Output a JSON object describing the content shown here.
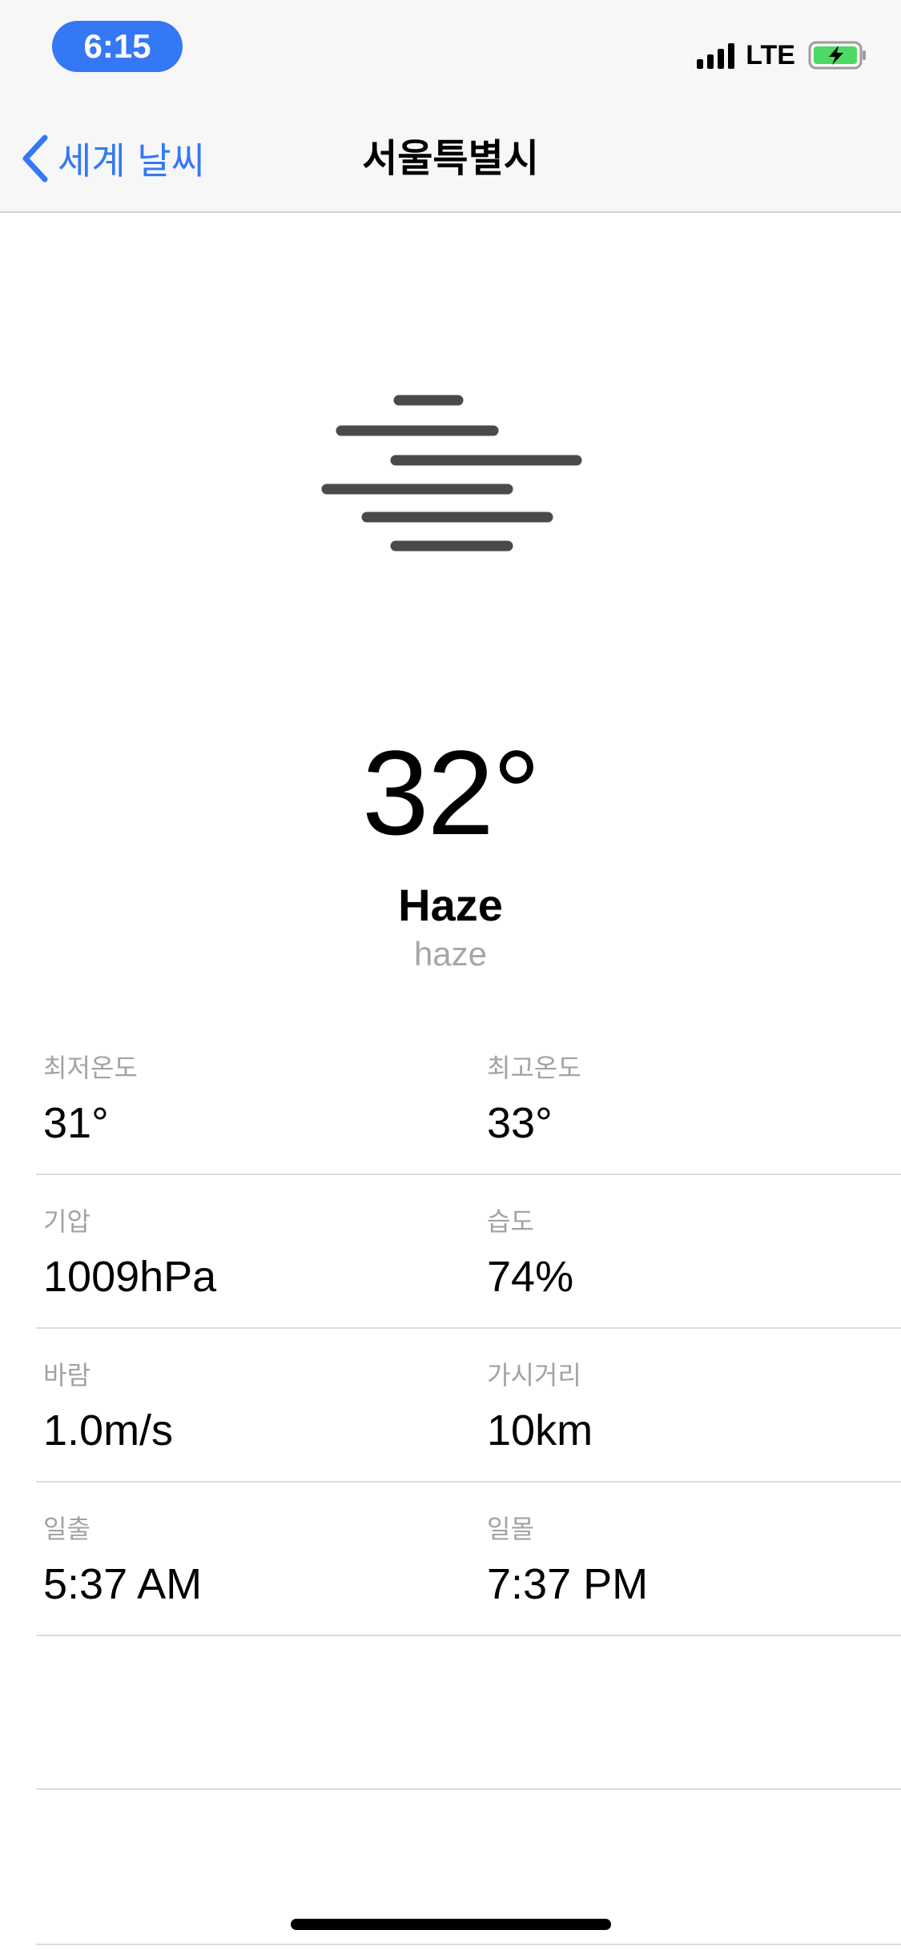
{
  "status_bar": {
    "time": "6:15",
    "network": "LTE",
    "time_pill_color": "#3478f6",
    "battery_color": "#4cd964"
  },
  "nav": {
    "back_label": "세계 날씨",
    "back_icon": "chevron-left-icon",
    "title": "서울특별시",
    "accent_color": "#3478f6"
  },
  "current": {
    "icon": "haze-icon",
    "temperature": "32°",
    "condition": "Haze",
    "description": "haze"
  },
  "details": [
    {
      "label": "최저온도",
      "value": "31°"
    },
    {
      "label": "최고온도",
      "value": "33°"
    },
    {
      "label": "기압",
      "value": "1009hPa"
    },
    {
      "label": "습도",
      "value": "74%"
    },
    {
      "label": "바람",
      "value": "1.0m/s"
    },
    {
      "label": "가시거리",
      "value": "10km"
    },
    {
      "label": "일출",
      "value": "5:37 AM"
    },
    {
      "label": "일몰",
      "value": "7:37 PM"
    }
  ]
}
